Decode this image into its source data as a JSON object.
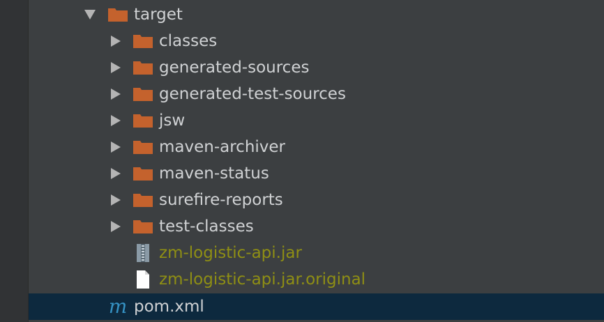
{
  "tree": {
    "root": {
      "label": "target",
      "expanded": true,
      "icon": "folder-icon"
    },
    "folders": [
      {
        "label": "classes"
      },
      {
        "label": "generated-sources"
      },
      {
        "label": "generated-test-sources"
      },
      {
        "label": "jsw"
      },
      {
        "label": "maven-archiver"
      },
      {
        "label": "maven-status"
      },
      {
        "label": "surefire-reports"
      },
      {
        "label": "test-classes"
      }
    ],
    "files": [
      {
        "label": "zm-logistic-api.jar",
        "icon": "jar-archive-icon",
        "status": "excluded"
      },
      {
        "label": "zm-logistic-api.jar.original",
        "icon": "file-icon",
        "status": "excluded"
      }
    ],
    "pom": {
      "label": "pom.xml",
      "icon": "maven-icon",
      "glyph": "m",
      "selected": true
    }
  },
  "colors": {
    "background": "#3c3f41",
    "gutter": "#313335",
    "folder": "#c4622d",
    "text": "#d0d2d4",
    "excluded_text": "#8f8f14",
    "selection": "#0d293e",
    "maven_icon": "#3592c4"
  }
}
